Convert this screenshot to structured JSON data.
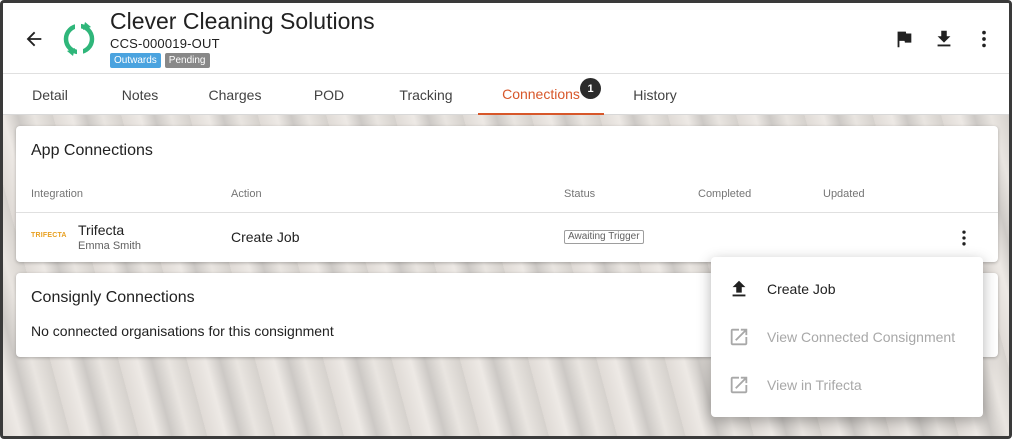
{
  "header": {
    "company": "Clever Cleaning Solutions",
    "reference": "CCS-000019-OUT",
    "badges": {
      "direction": "Outwards",
      "state": "Pending"
    }
  },
  "tabs": [
    {
      "label": "Detail"
    },
    {
      "label": "Notes"
    },
    {
      "label": "Charges"
    },
    {
      "label": "POD"
    },
    {
      "label": "Tracking"
    },
    {
      "label": "Connections",
      "badge": "1",
      "active": true
    },
    {
      "label": "History"
    }
  ],
  "app_connections": {
    "title": "App Connections",
    "columns": [
      "Integration",
      "Action",
      "Status",
      "Completed",
      "Updated"
    ],
    "rows": [
      {
        "logo_text": "TRIFECTA",
        "integration": "Trifecta",
        "user": "Emma Smith",
        "action": "Create Job",
        "status": "Awaiting Trigger"
      }
    ]
  },
  "consignly_connections": {
    "title": "Consignly Connections",
    "empty_message": "No connected organisations for this consignment"
  },
  "menu": {
    "items": [
      {
        "label": "Create Job",
        "icon": "upload-icon",
        "disabled": false
      },
      {
        "label": "View Connected Consignment",
        "icon": "open-in-new-icon",
        "disabled": true
      },
      {
        "label": "View in Trifecta",
        "icon": "open-in-new-icon",
        "disabled": true
      }
    ]
  },
  "colors": {
    "accent": "#d7572a",
    "logo_green": "#2fb67a",
    "badge_blue": "#4aa3df",
    "badge_grey": "#888888"
  }
}
